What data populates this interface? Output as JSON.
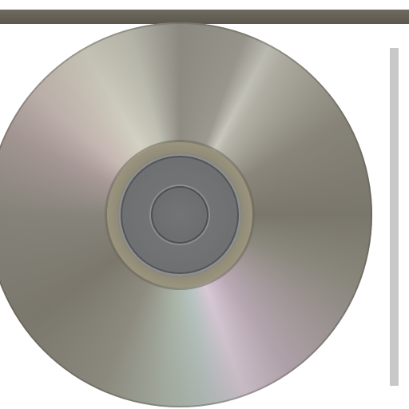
{
  "scene": {
    "subject": "compact disc",
    "colors": {
      "top_bar": "#5c584d",
      "disc_base": "#8f8c84",
      "hub": "#6e6f71",
      "scrollbar": "#c8c8c8"
    }
  }
}
